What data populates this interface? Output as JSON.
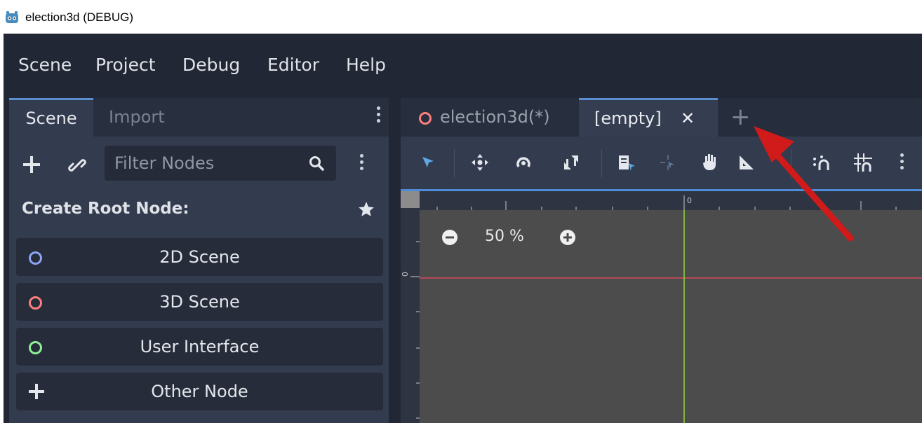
{
  "window": {
    "title": "election3d (DEBUG)"
  },
  "menu": {
    "items": [
      "Scene",
      "Project",
      "Debug",
      "Editor",
      "Help"
    ]
  },
  "scene_dock": {
    "tabs": [
      "Scene",
      "Import"
    ],
    "active_tab": "Scene",
    "filter_placeholder": "Filter Nodes",
    "create_root_label": "Create Root Node:",
    "root_buttons": [
      {
        "label": "2D Scene",
        "icon": "circle-icon",
        "color": "#8da5f3"
      },
      {
        "label": "3D Scene",
        "icon": "circle-icon",
        "color": "#fc7f7f"
      },
      {
        "label": "User Interface",
        "icon": "circle-icon",
        "color": "#8eef97"
      },
      {
        "label": "Other Node",
        "icon": "plus-icon",
        "color": "#e0e0e0"
      }
    ]
  },
  "editor": {
    "tabs": [
      {
        "label": "election3d(*)",
        "icon": "circle-icon",
        "color": "#fc7f7f"
      },
      {
        "label": "[empty]",
        "close": "✕"
      }
    ],
    "active_tab": "[empty]",
    "new_tab_label": "+",
    "zoom": "50 %",
    "ruler_origin_label": "0"
  },
  "colors": {
    "accent": "#5b8fd0",
    "annotation_arrow": "#d11a1a",
    "x_axis": "#d64b5d",
    "y_axis": "#8fd63d"
  }
}
